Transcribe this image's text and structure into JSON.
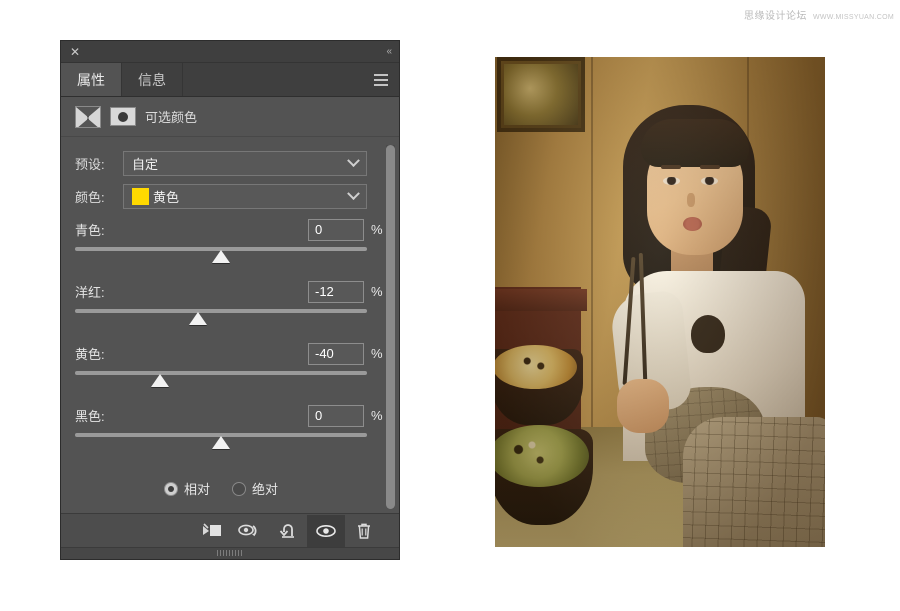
{
  "watermark": {
    "name": "思缘设计论坛",
    "url": "WWW.MISSYUAN.COM"
  },
  "panel": {
    "close_label": "✕",
    "collapse_label": "«",
    "menu_icon": "hamburger-menu-icon",
    "tabs": [
      {
        "label": "属性",
        "active": true
      },
      {
        "label": "信息",
        "active": false
      }
    ],
    "adjustment": {
      "icon": "selective-color-icon",
      "mask_icon": "layer-mask-thumbnail",
      "title": "可选颜色"
    },
    "preset_row": {
      "label": "预设:",
      "value": "自定",
      "chevron": "chevron-down-icon"
    },
    "color_row": {
      "label": "颜色:",
      "value": "黄色",
      "swatch_color": "#ffd900",
      "chevron": "chevron-down-icon"
    },
    "sliders": [
      {
        "name": "青色:",
        "value": "0",
        "unit": "%",
        "knob_pct": 50
      },
      {
        "name": "洋红:",
        "value": "-12",
        "unit": "%",
        "knob_pct": 42
      },
      {
        "name": "黄色:",
        "value": "-40",
        "unit": "%",
        "knob_pct": 29
      },
      {
        "name": "黑色:",
        "value": "0",
        "unit": "%",
        "knob_pct": 50
      }
    ],
    "mode": {
      "options": [
        {
          "label": "相对",
          "selected": true
        },
        {
          "label": "绝对",
          "selected": false
        }
      ]
    },
    "footer_tools": [
      {
        "icon": "clip-to-layer-icon",
        "active": false
      },
      {
        "icon": "view-previous-state-icon",
        "active": false
      },
      {
        "icon": "reset-adjustment-icon",
        "active": false
      },
      {
        "icon": "toggle-visibility-icon",
        "active": true
      },
      {
        "icon": "delete-layer-icon",
        "active": false
      }
    ],
    "resize_grip": "resize-grip"
  },
  "photo": {
    "alt": "woman-eating-with-chopsticks-photo"
  }
}
